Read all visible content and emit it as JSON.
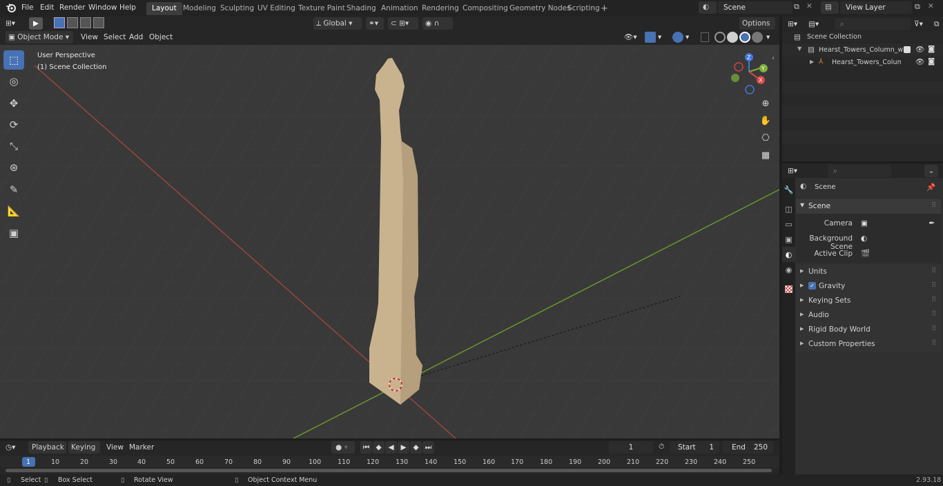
{
  "topbar": {
    "menus": [
      "File",
      "Edit",
      "Render",
      "Window",
      "Help"
    ],
    "workspaces": [
      "Layout",
      "Modeling",
      "Sculpting",
      "UV Editing",
      "Texture Paint",
      "Shading",
      "Animation",
      "Rendering",
      "Compositing",
      "Geometry Nodes",
      "Scripting"
    ],
    "add_tab": "+",
    "scene_name": "Scene",
    "view_layer": "View Layer"
  },
  "header3d": {
    "orientation": "Global",
    "options": "Options",
    "mode": "Object Mode",
    "menus": [
      "View",
      "Select",
      "Add",
      "Object"
    ]
  },
  "viewport": {
    "perspective": "User Perspective",
    "collection": "(1) Scene Collection",
    "gizmo": {
      "z": "Z",
      "y": "Y",
      "x": "X"
    }
  },
  "outliner": {
    "root": "Scene Collection",
    "items": [
      "Hearst_Towers_Column_with_",
      "Hearst_Towers_Column_"
    ]
  },
  "properties": {
    "context": "Scene",
    "panel": "Scene",
    "fields": [
      {
        "label": "Camera"
      },
      {
        "label": "Background Scene"
      },
      {
        "label": "Active Clip"
      }
    ],
    "sections": [
      "Units",
      "Gravity",
      "Keying Sets",
      "Audio",
      "Rigid Body World",
      "Custom Properties"
    ]
  },
  "timeline": {
    "menus": [
      "Playback",
      "Keying",
      "View",
      "Marker"
    ],
    "current_frame": "1",
    "start_label": "Start",
    "start": "1",
    "end_label": "End",
    "end": "250",
    "ticks": [
      "1",
      "10",
      "20",
      "30",
      "40",
      "50",
      "60",
      "70",
      "80",
      "90",
      "100",
      "110",
      "120",
      "130",
      "140",
      "150",
      "160",
      "170",
      "180",
      "190",
      "200",
      "210",
      "220",
      "230",
      "240",
      "250"
    ]
  },
  "status": {
    "items": [
      "Select",
      "Box Select",
      "Rotate View",
      "Object Context Menu"
    ],
    "version": "2.93.18"
  },
  "colors": {
    "accent": "#4772b3",
    "x_axis": "#b84a4a",
    "y_axis": "#7aa533",
    "object": "#c9b38f"
  }
}
